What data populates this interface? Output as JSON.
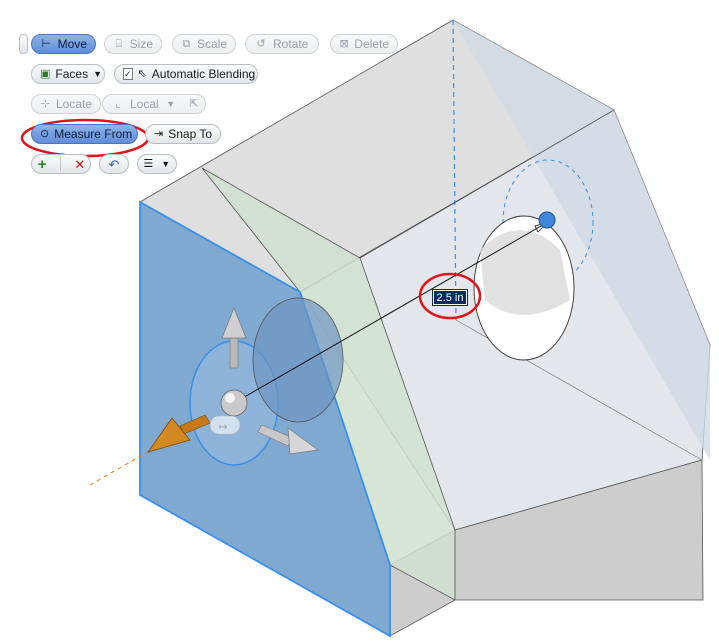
{
  "toolbar": {
    "row1": {
      "move": "Move",
      "size": "Size",
      "scale": "Scale",
      "rotate": "Rotate",
      "delete": "Delete"
    },
    "row2": {
      "faces": "Faces",
      "automatic_blending": "Automatic Blending",
      "automatic_blending_checked": true
    },
    "row3": {
      "locate": "Locate",
      "local": "Local"
    },
    "row4": {
      "measure_from": "Measure From",
      "snap_to": "Snap To"
    },
    "row5": {
      "accept_icon": "plus-icon",
      "cancel_icon": "x-icon",
      "undo_icon": "undo-arrow-icon",
      "options_icon": "options-menu-icon"
    }
  },
  "viewport": {
    "dimension_value": "2.5 in",
    "icons": [
      "triad-sphere-icon",
      "x-axis-arrow-icon",
      "y-axis-arrow-icon",
      "z-axis-arrow-icon",
      "target-point-icon"
    ]
  },
  "colors": {
    "selected_face": "#6a9ac9",
    "selected_edge": "#3a8fe8",
    "body": "#d6d7d8",
    "active_button": "#6f98dc",
    "annotation": "#e0141b",
    "arrow_orange": "#c77b17"
  }
}
